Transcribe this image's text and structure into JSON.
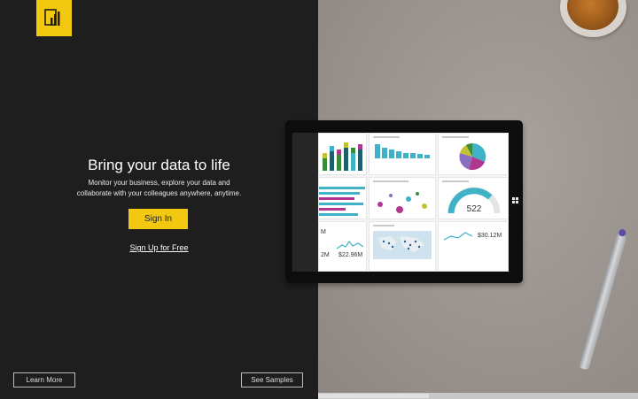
{
  "hero": {
    "title": "Bring your data to life",
    "subtitle_line1": "Monitor your business, explore your data and",
    "subtitle_line2": "collaborate with your colleagues anywhere, anytime."
  },
  "actions": {
    "sign_in": "Sign In",
    "sign_up": "Sign Up for Free",
    "learn_more": "Learn More",
    "see_samples": "See Samples"
  },
  "tablet_screen": {
    "kpi_522": "522",
    "kpi_30m": "$30.12M",
    "kpi_22m": "$22.96M",
    "kpi_2m": "2M",
    "kpi_m": "M"
  },
  "colors": {
    "brand_yellow": "#f2c811",
    "dark_background": "#1e1e1e",
    "accent_teal": "#3fb2c8"
  },
  "icons": {
    "logo": "power-bi-logo-icon",
    "windows": "windows-icon"
  }
}
